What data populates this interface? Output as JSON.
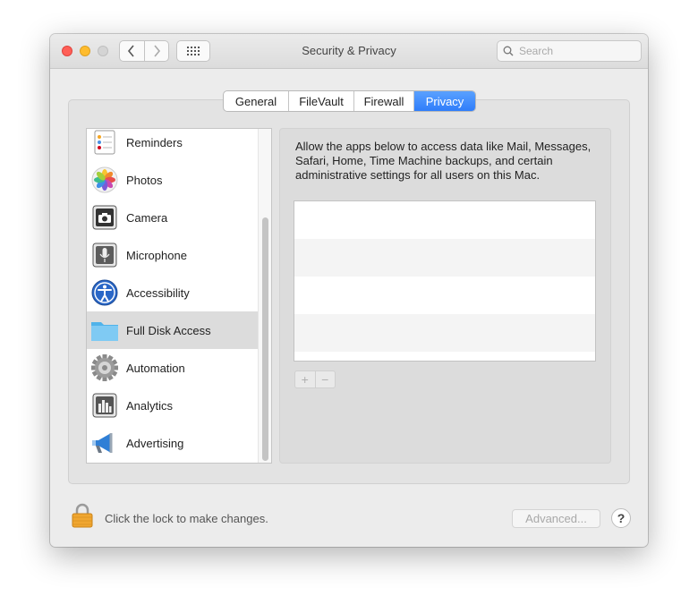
{
  "window": {
    "title": "Security & Privacy"
  },
  "search": {
    "placeholder": "Search"
  },
  "tabs": [
    {
      "label": "General"
    },
    {
      "label": "FileVault"
    },
    {
      "label": "Firewall"
    },
    {
      "label": "Privacy",
      "selected": true
    }
  ],
  "sidebar": {
    "items": [
      {
        "label": "Reminders",
        "icon": "reminders-icon"
      },
      {
        "label": "Photos",
        "icon": "photos-icon"
      },
      {
        "label": "Camera",
        "icon": "camera-icon"
      },
      {
        "label": "Microphone",
        "icon": "microphone-icon"
      },
      {
        "label": "Accessibility",
        "icon": "accessibility-icon"
      },
      {
        "label": "Full Disk Access",
        "icon": "folder-icon",
        "selected": true
      },
      {
        "label": "Automation",
        "icon": "gear-icon"
      },
      {
        "label": "Analytics",
        "icon": "analytics-icon"
      },
      {
        "label": "Advertising",
        "icon": "megaphone-icon"
      }
    ]
  },
  "main": {
    "description": "Allow the apps below to access data like Mail, Messages, Safari, Home, Time Machine backups, and certain administrative settings for all users on this Mac.",
    "add_label": "+",
    "remove_label": "−"
  },
  "footer": {
    "lock_text": "Click the lock to make changes.",
    "advanced_label": "Advanced...",
    "help_label": "?"
  },
  "colors": {
    "accent": "#3d86fb",
    "selected_row": "#dcdcdc"
  }
}
